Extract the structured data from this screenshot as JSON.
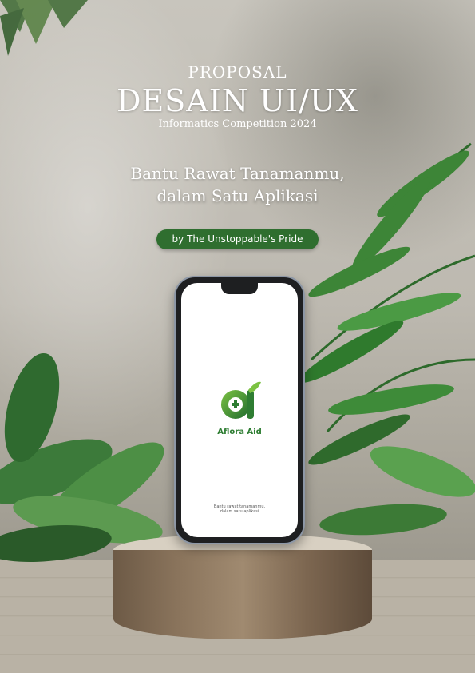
{
  "header": {
    "kicker": "PROPOSAL",
    "title": "DESAIN UI/UX",
    "event": "Informatics Competition 2024"
  },
  "tagline": {
    "line1": "Bantu Rawat Tanamanmu,",
    "line2": "dalam Satu Aplikasi"
  },
  "author": {
    "label": "by The Unstoppable's Pride"
  },
  "phone": {
    "app_name": "Aflora Aid",
    "app_tagline_line1": "Bantu rawat tanamanmu,",
    "app_tagline_line2": "dalam satu aplikasi"
  },
  "colors": {
    "brand_green": "#2e7d32",
    "pill_green": "#2f6e2f"
  }
}
